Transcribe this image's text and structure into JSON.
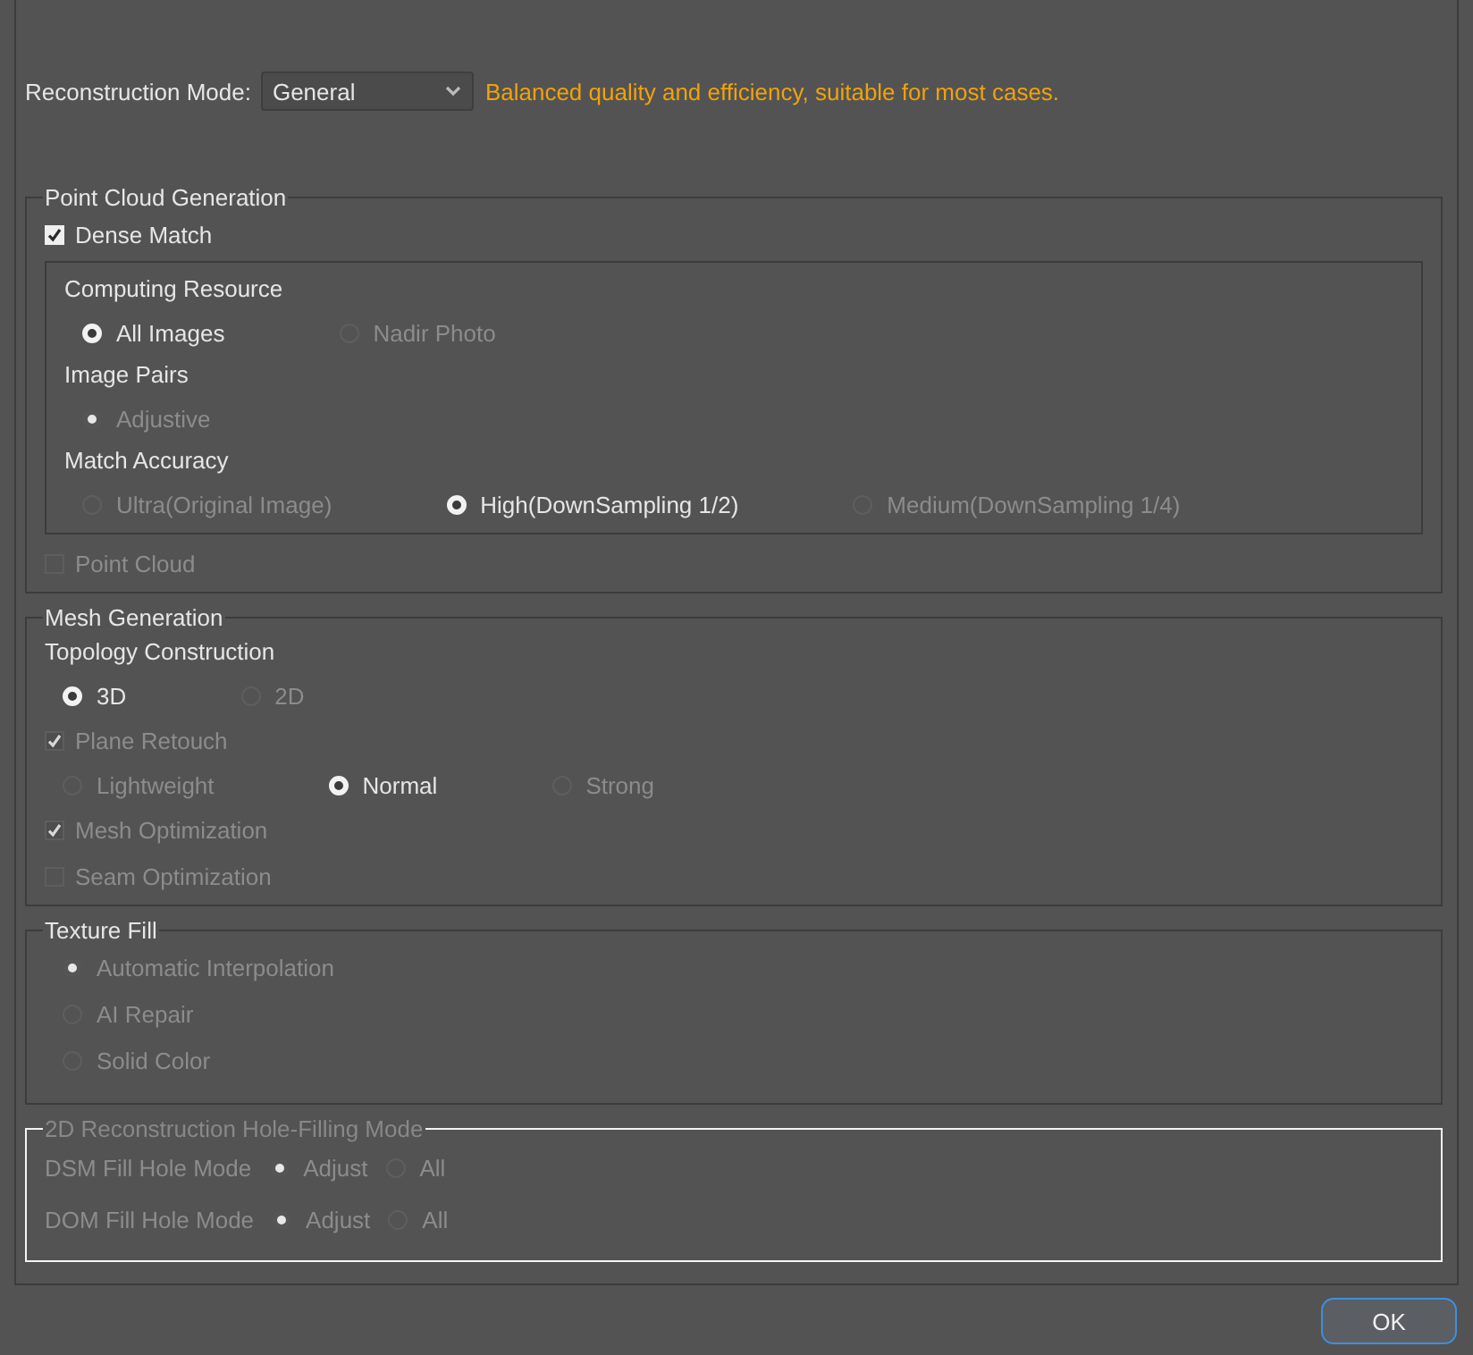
{
  "mode": {
    "label": "Reconstruction Mode:",
    "value": "General",
    "hint": "Balanced quality and efficiency, suitable for most cases."
  },
  "groups": [
    {
      "title": "Point Cloud Generation",
      "highlighted": false,
      "disabled": false,
      "items": [
        {
          "kind": "checkbox",
          "label": "Dense Match",
          "checked": true,
          "disabled": false
        },
        {
          "kind": "subgroup",
          "items": [
            {
              "kind": "heading",
              "label": "Computing Resource"
            },
            {
              "kind": "radios",
              "options": [
                {
                  "label": "All Images",
                  "selected": true,
                  "disabled": false
                },
                {
                  "label": "Nadir Photo",
                  "selected": false,
                  "disabled": true
                }
              ]
            },
            {
              "kind": "heading",
              "label": "Image Pairs"
            },
            {
              "kind": "radios",
              "options": [
                {
                  "label": "Adjustive",
                  "selected": true,
                  "disabled": true
                }
              ]
            },
            {
              "kind": "heading",
              "label": "Match Accuracy"
            },
            {
              "kind": "radios",
              "options": [
                {
                  "label": "Ultra(Original Image)",
                  "selected": false,
                  "disabled": true
                },
                {
                  "label": "High(DownSampling 1/2)",
                  "selected": true,
                  "disabled": false
                },
                {
                  "label": "Medium(DownSampling 1/4)",
                  "selected": false,
                  "disabled": true
                }
              ]
            }
          ]
        },
        {
          "kind": "checkbox",
          "label": "Point Cloud",
          "checked": false,
          "disabled": true
        }
      ]
    },
    {
      "title": "Mesh Generation",
      "highlighted": false,
      "disabled": false,
      "items": [
        {
          "kind": "heading",
          "label": "Topology Construction"
        },
        {
          "kind": "radios",
          "options": [
            {
              "label": "3D",
              "selected": true,
              "disabled": false
            },
            {
              "label": "2D",
              "selected": false,
              "disabled": true
            }
          ]
        },
        {
          "kind": "checkbox",
          "label": "Plane Retouch",
          "checked": true,
          "disabled": true
        },
        {
          "kind": "radios",
          "options": [
            {
              "label": "Lightweight",
              "selected": false,
              "disabled": true
            },
            {
              "label": "Normal",
              "selected": true,
              "disabled": false
            },
            {
              "label": "Strong",
              "selected": false,
              "disabled": true
            }
          ]
        },
        {
          "kind": "checkbox",
          "label": "Mesh Optimization",
          "checked": true,
          "disabled": true
        },
        {
          "kind": "checkbox",
          "label": "Seam Optimization",
          "checked": false,
          "disabled": true
        }
      ]
    },
    {
      "title": "Texture Fill",
      "highlighted": false,
      "disabled": false,
      "items": [
        {
          "kind": "radio_column",
          "options": [
            {
              "label": "Automatic Interpolation",
              "selected": true,
              "disabled": true
            },
            {
              "label": "AI Repair",
              "selected": false,
              "disabled": true
            },
            {
              "label": "Solid Color",
              "selected": false,
              "disabled": true
            }
          ]
        }
      ]
    },
    {
      "title": "2D Reconstruction Hole-Filling Mode",
      "highlighted": true,
      "disabled": true,
      "items": [
        {
          "kind": "labeled_radios",
          "label": "DSM Fill Hole Mode",
          "disabled": true,
          "options": [
            {
              "label": "Adjust",
              "selected": true,
              "disabled": true
            },
            {
              "label": "All",
              "selected": false,
              "disabled": true
            }
          ]
        },
        {
          "kind": "labeled_radios",
          "label": "DOM Fill Hole Mode",
          "disabled": true,
          "options": [
            {
              "label": "Adjust",
              "selected": true,
              "disabled": true
            },
            {
              "label": "All",
              "selected": false,
              "disabled": true
            }
          ]
        }
      ]
    }
  ],
  "ok_button": "OK"
}
